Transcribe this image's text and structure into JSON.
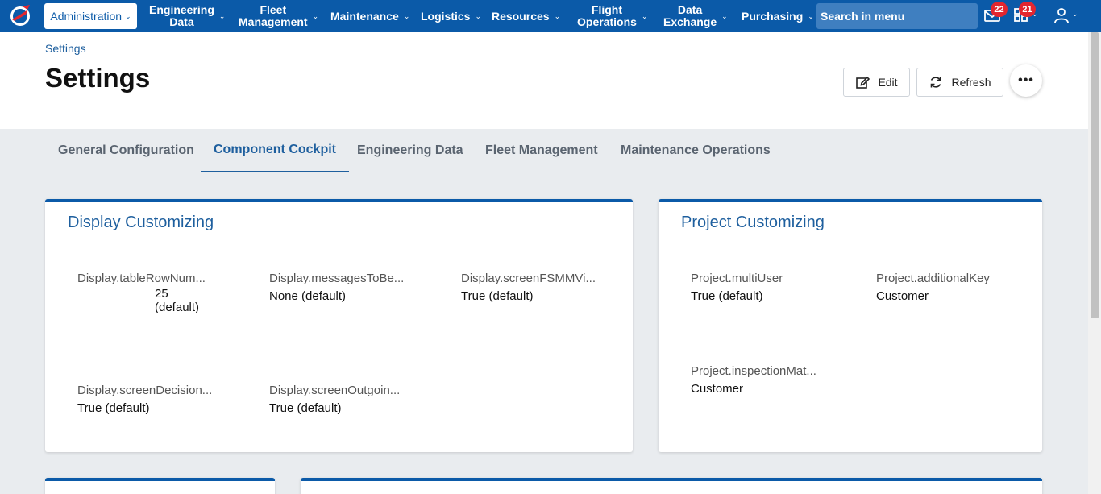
{
  "nav": {
    "admin": "Administration",
    "items": [
      {
        "label": "Engineering\nData"
      },
      {
        "label": "Fleet\nManagement"
      },
      {
        "label": "Maintenance"
      },
      {
        "label": "Logistics"
      },
      {
        "label": "Resources"
      },
      {
        "label": "Flight\nOperations"
      },
      {
        "label": "Data\nExchange"
      },
      {
        "label": "Purchasing"
      }
    ],
    "search_text": "Search in menu",
    "mail_badge": "22",
    "apps_badge": "21"
  },
  "header": {
    "breadcrumb": "Settings",
    "title": "Settings",
    "edit_label": "Edit",
    "refresh_label": "Refresh",
    "more_label": "•••"
  },
  "tabs": [
    {
      "label": "General Configuration",
      "active": false
    },
    {
      "label": "Component Cockpit",
      "active": true
    },
    {
      "label": "Engineering Data",
      "active": false
    },
    {
      "label": "Fleet Management",
      "active": false
    },
    {
      "label": "Maintenance Operations",
      "active": false
    }
  ],
  "display_card": {
    "title": "Display Customizing",
    "settings": [
      {
        "key": "Display.tableRowNum...",
        "value": "25\n(default)"
      },
      {
        "key": "Display.messagesToBe...",
        "value": "None (default)"
      },
      {
        "key": "Display.screenFSMMVi...",
        "value": "True (default)"
      },
      {
        "key": "Display.screenDecision...",
        "value": "True (default)"
      },
      {
        "key": "Display.screenOutgoin...",
        "value": "True (default)"
      }
    ]
  },
  "project_card": {
    "title": "Project Customizing",
    "settings": [
      {
        "key": "Project.multiUser",
        "value": "True (default)"
      },
      {
        "key": "Project.additionalKey",
        "value": "Customer"
      },
      {
        "key": "Project.inspectionMat...",
        "value": "Customer"
      }
    ]
  },
  "colors": {
    "brand": "#0b5aa8",
    "accent_text": "#1e5f9e",
    "badge": "#e3262f"
  }
}
